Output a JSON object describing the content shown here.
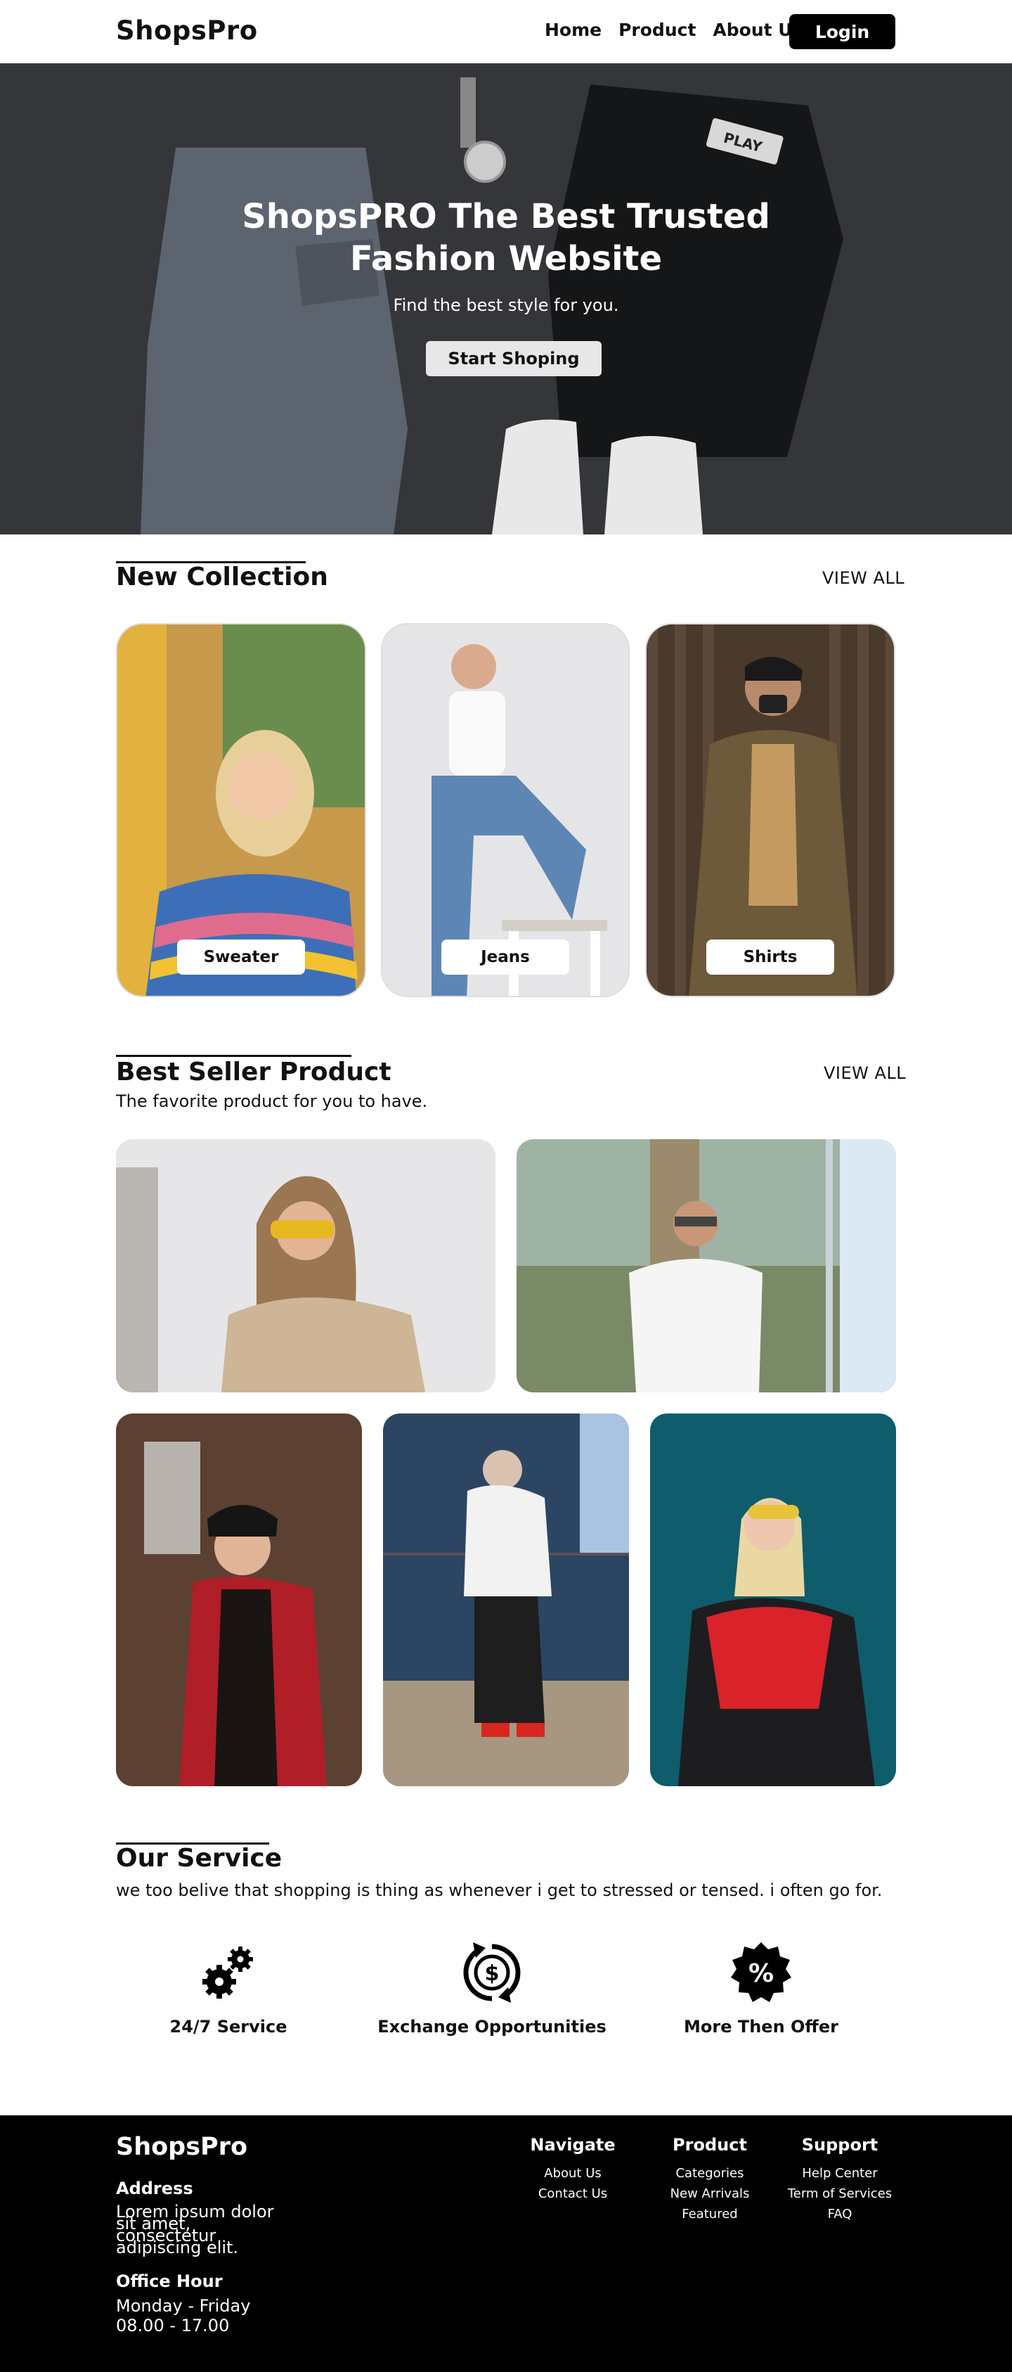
{
  "nav": {
    "logo": "ShopsPro",
    "links": [
      "Home",
      "Product",
      "About Us"
    ],
    "login": "Login"
  },
  "hero": {
    "title_line1": "ShopsPRO The Best Trusted",
    "title_line2": "Fashion Website",
    "subtitle": "Find the best style for you.",
    "cta": "Start Shoping",
    "shirt_tag": "PLAY"
  },
  "new_collection": {
    "title": "New Collection",
    "view_all": "VIEW ALL",
    "items": [
      {
        "label": "Sweater"
      },
      {
        "label": "Jeans"
      },
      {
        "label": "Shirts"
      }
    ]
  },
  "best_seller": {
    "title": "Best Seller Product",
    "subtitle": "The favorite product for you to have.",
    "view_all": "VIEW ALL"
  },
  "service": {
    "title": "Our Service",
    "subtitle": "we too belive that shopping is thing as whenever i get to stressed or tensed. i often go for.",
    "items": [
      {
        "icon": "gears-icon",
        "label": "24/7 Service"
      },
      {
        "icon": "dollar-exchange-icon",
        "label": "Exchange Opportunities"
      },
      {
        "icon": "discount-badge-icon",
        "label": "More Then Offer"
      }
    ]
  },
  "footer": {
    "logo": "ShopsPro",
    "address_heading": "Address",
    "address_lines": [
      "Lorem ipsum dolor",
      "sit amet,",
      "consectetur",
      "adipiscing elit."
    ],
    "office_heading": "Office Hour",
    "office_days": "Monday - Friday",
    "office_time": "08.00 - 17.00",
    "navigate": {
      "heading": "Navigate",
      "items": [
        "About Us",
        "Contact Us"
      ]
    },
    "product": {
      "heading": "Product",
      "items": [
        "Categories",
        "New Arrivals",
        "Featured"
      ]
    },
    "support": {
      "heading": "Support",
      "items": [
        "Help Center",
        "Term of Services",
        "FAQ"
      ]
    }
  },
  "colors": {
    "dark": "#000000",
    "hero_bg": "#35363a",
    "button_light": "#e7e7e7"
  }
}
